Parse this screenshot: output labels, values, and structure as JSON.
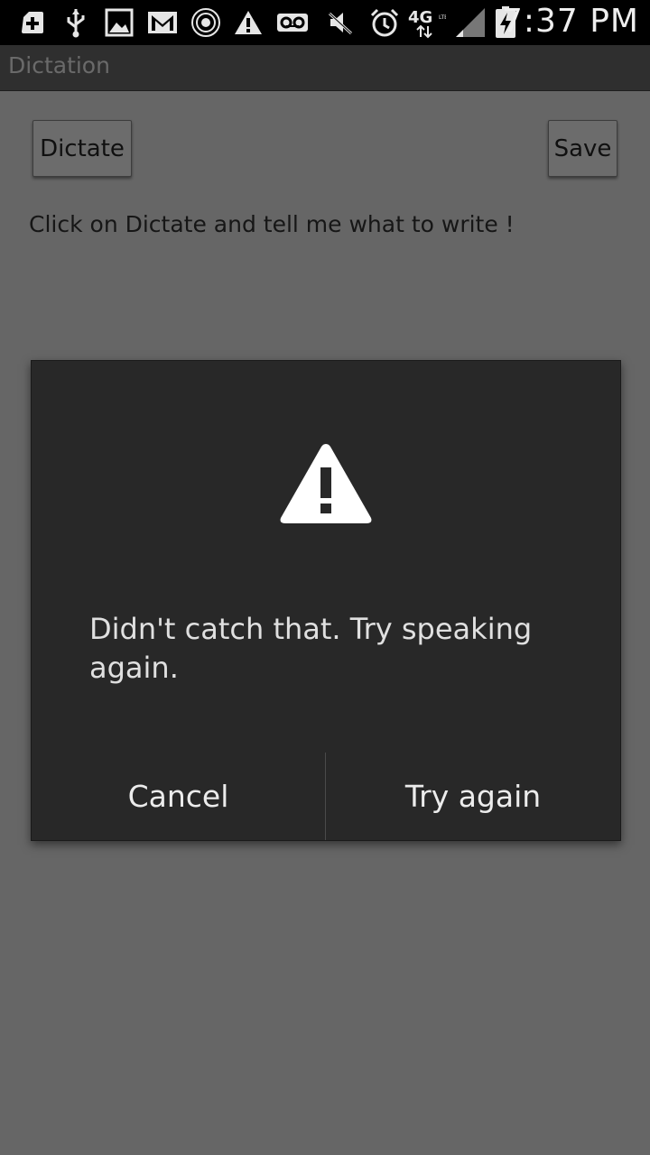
{
  "status_bar": {
    "time": "7:37 PM",
    "network": "4G",
    "icons": [
      "add-box-icon",
      "usb-icon",
      "image-icon",
      "gmail-icon",
      "hotspot-icon",
      "warning-icon",
      "voicemail-icon",
      "mute-icon",
      "alarm-icon",
      "4g-lte-icon",
      "signal-icon",
      "battery-charging-icon"
    ]
  },
  "action_bar": {
    "title": "Dictation"
  },
  "content": {
    "dictate_label": "Dictate",
    "save_label": "Save",
    "hint": "Click on Dictate and tell me what to write !"
  },
  "dialog": {
    "icon": "warning-icon",
    "message": "Didn't catch that. Try speaking again.",
    "cancel_label": "Cancel",
    "try_again_label": "Try again"
  }
}
